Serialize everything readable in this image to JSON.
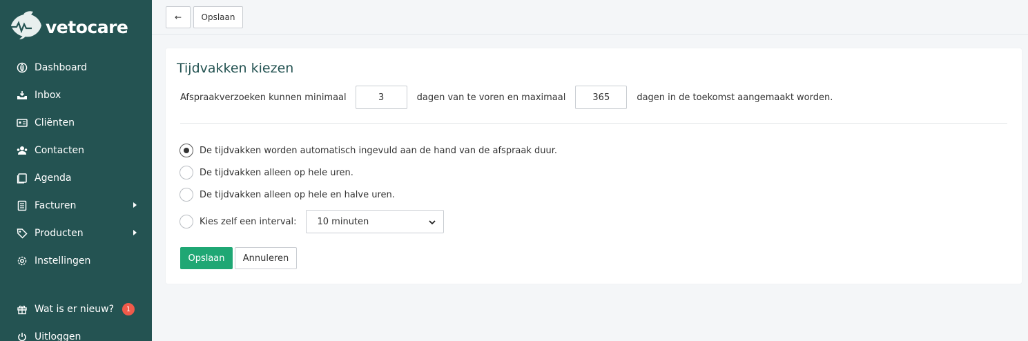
{
  "brand": {
    "name": "vetocare",
    "logo_icon": "fish-heartbeat-logo"
  },
  "colors": {
    "sidebar": "#245352",
    "accent": "#1fa774",
    "badge": "#f05a4a",
    "title": "#245352"
  },
  "sidebar": {
    "items": [
      {
        "label": "Dashboard",
        "icon": "leaf-icon"
      },
      {
        "label": "Inbox",
        "icon": "inbox-icon"
      },
      {
        "label": "Cliënten",
        "icon": "id-card-icon"
      },
      {
        "label": "Contacten",
        "icon": "users-icon"
      },
      {
        "label": "Agenda",
        "icon": "calendar-icon"
      },
      {
        "label": "Facturen",
        "icon": "invoice-icon",
        "submenu": true
      },
      {
        "label": "Producten",
        "icon": "tag-icon",
        "submenu": true
      },
      {
        "label": "Instellingen",
        "icon": "gear-icon"
      }
    ],
    "whats_new": {
      "label": "Wat is er nieuw?",
      "badge": "1",
      "icon": "gift-icon"
    },
    "logout": {
      "label": "Uitloggen",
      "icon": "power-icon"
    }
  },
  "toolbar": {
    "back_label": "←",
    "save_label": "Opslaan"
  },
  "card": {
    "title": "Tijdvakken kiezen",
    "sentence": {
      "part1": "Afspraakverzoeken kunnen minimaal",
      "min_days": "3",
      "part2": "dagen van te voren en maximaal",
      "max_days": "365",
      "part3": "dagen in de toekomst aangemaakt worden."
    },
    "options": [
      {
        "label": "De tijdvakken worden automatisch ingevuld aan de hand van de afspraak duur.",
        "checked": true
      },
      {
        "label": "De tijdvakken alleen op hele uren.",
        "checked": false
      },
      {
        "label": "De tijdvakken alleen op hele en halve uren.",
        "checked": false
      },
      {
        "label": "Kies zelf een interval:",
        "checked": false
      }
    ],
    "interval_select": {
      "value": "10 minuten"
    },
    "save_label": "Opslaan",
    "cancel_label": "Annuleren"
  }
}
